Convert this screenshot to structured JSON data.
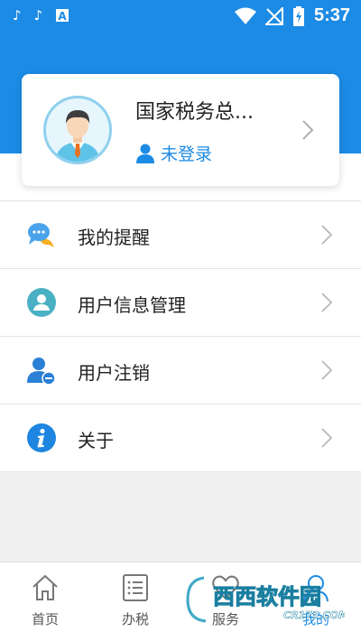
{
  "status_bar": {
    "time": "5:37"
  },
  "profile": {
    "org_name": "国家税务总...",
    "login_status": "未登录"
  },
  "menu": {
    "items": [
      {
        "label": "我的提醒",
        "icon": "chat-bubble-icon"
      },
      {
        "label": "用户信息管理",
        "icon": "user-circle-icon"
      },
      {
        "label": "用户注销",
        "icon": "user-remove-icon"
      },
      {
        "label": "关于",
        "icon": "info-icon"
      }
    ]
  },
  "tabbar": {
    "tabs": [
      {
        "label": "首页",
        "icon": "home-icon"
      },
      {
        "label": "办税",
        "icon": "list-icon"
      },
      {
        "label": "服务",
        "icon": "heart-icon"
      },
      {
        "label": "我的",
        "icon": "person-icon",
        "active": true
      }
    ]
  },
  "watermark": {
    "text": "西西软件园",
    "sub": "CR173.COM"
  },
  "colors": {
    "accent": "#1c8be5",
    "avatar_ring": "#8fd0ee"
  }
}
